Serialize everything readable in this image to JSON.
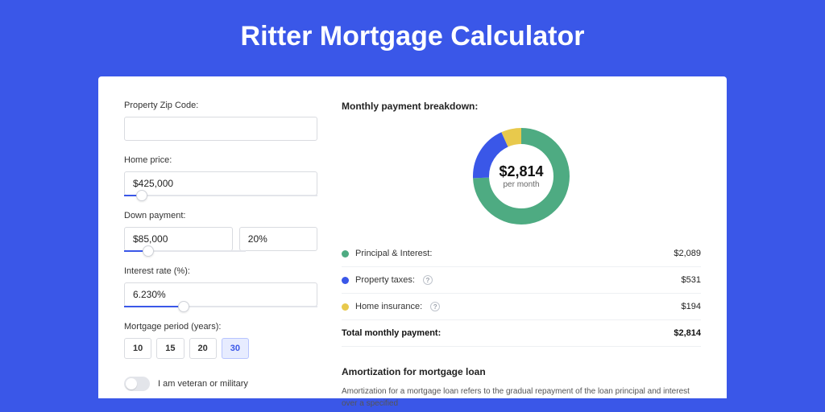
{
  "hero": {
    "title": "Ritter Mortgage Calculator"
  },
  "form": {
    "zip_label": "Property Zip Code:",
    "zip_value": "",
    "home_price_label": "Home price:",
    "home_price_value": "$425,000",
    "home_price_slider_pct": 9,
    "down_label": "Down payment:",
    "down_value": "$85,000",
    "down_pct_value": "20%",
    "down_slider_pct": 20,
    "rate_label": "Interest rate (%):",
    "rate_value": "6.230%",
    "rate_slider_pct": 31,
    "period_label": "Mortgage period (years):",
    "periods": [
      "10",
      "15",
      "20",
      "30"
    ],
    "period_active_index": 3,
    "veteran_label": "I am veteran or military"
  },
  "breakdown": {
    "title": "Monthly payment breakdown:",
    "donut_value": "$2,814",
    "donut_sub": "per month",
    "items": [
      {
        "label": "Principal & Interest:",
        "amount": "$2,089",
        "color": "#4eab82"
      },
      {
        "label": "Property taxes:",
        "amount": "$531",
        "color": "#3a57e8",
        "info": true
      },
      {
        "label": "Home insurance:",
        "amount": "$194",
        "color": "#e8c94c",
        "info": true
      }
    ],
    "total_label": "Total monthly payment:",
    "total_amount": "$2,814"
  },
  "amort": {
    "title": "Amortization for mortgage loan",
    "body": "Amortization for a mortgage loan refers to the gradual repayment of the loan principal and interest over a specified"
  },
  "chart_data": {
    "type": "pie",
    "title": "Monthly payment breakdown",
    "series": [
      {
        "name": "Principal & Interest",
        "value": 2089,
        "color": "#4eab82"
      },
      {
        "name": "Property taxes",
        "value": 531,
        "color": "#3a57e8"
      },
      {
        "name": "Home insurance",
        "value": 194,
        "color": "#e8c94c"
      }
    ],
    "total": 2814,
    "center_label": "$2,814 per month"
  }
}
